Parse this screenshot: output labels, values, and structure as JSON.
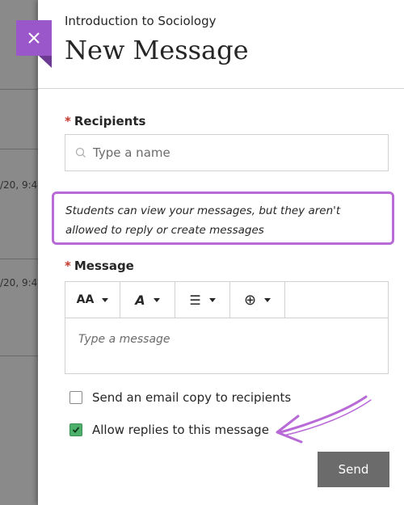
{
  "background": {
    "dates": [
      "/20, 9:4",
      "/20, 9:4"
    ]
  },
  "header": {
    "course": "Introduction to Sociology",
    "title": "New Message",
    "close_icon": "close-icon"
  },
  "recipients": {
    "label": "Recipients",
    "required_mark": "*",
    "placeholder": "Type a name",
    "icon": "search-icon"
  },
  "notice": {
    "text": "Students can view your messages, but they aren't allowed to reply or create messages"
  },
  "message": {
    "label": "Message",
    "required_mark": "*",
    "placeholder": "Type a message",
    "toolbar": [
      {
        "icon": "font-size-icon",
        "glyph": "AA"
      },
      {
        "icon": "text-color-icon",
        "glyph": "A"
      },
      {
        "icon": "list-icon",
        "glyph": "☰"
      },
      {
        "icon": "insert-icon",
        "glyph": "⊕"
      }
    ]
  },
  "options": {
    "email_copy_label": "Send an email copy to recipients",
    "email_copy_checked": false,
    "allow_replies_label": "Allow replies to this message",
    "allow_replies_checked": true
  },
  "actions": {
    "send_label": "Send"
  },
  "colors": {
    "accent_purple": "#9a57c9",
    "highlight": "#b86ad6",
    "checked": "#4caf6a"
  }
}
